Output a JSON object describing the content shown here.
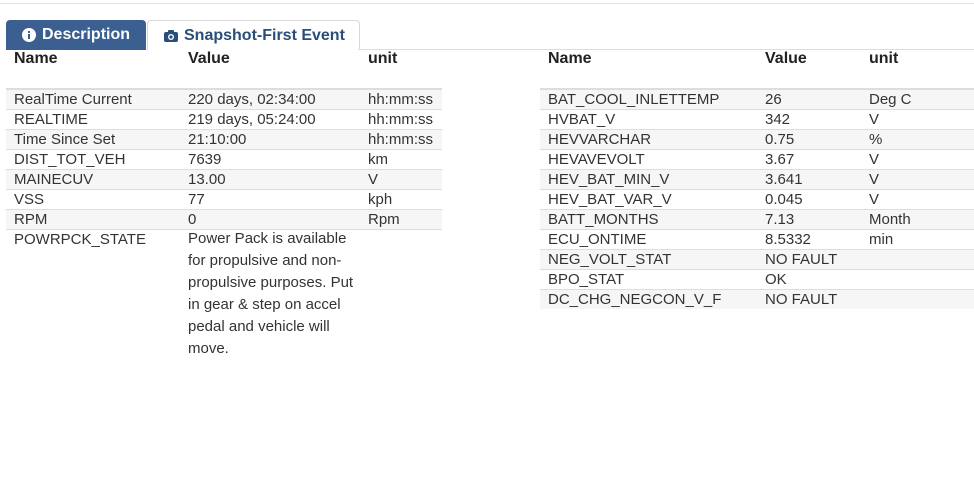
{
  "tabs": {
    "description": {
      "label": "Description",
      "icon": "info-circle-icon"
    },
    "snapshot": {
      "label": "Snapshot-First Event",
      "icon": "camera-icon"
    }
  },
  "colors": {
    "active_tab": "#3a5f90",
    "inactive_tab_text": "#2a4e7a",
    "stripe": "#f6f6f6"
  },
  "left_table": {
    "headers": [
      "Name",
      "Value",
      "unit"
    ],
    "rows": [
      [
        "RealTime Current",
        "220 days, 02:34:00",
        "hh:mm:ss"
      ],
      [
        "REALTIME",
        "219 days, 05:24:00",
        "hh:mm:ss"
      ],
      [
        "Time Since Set",
        "21:10:00",
        "hh:mm:ss"
      ],
      [
        "DIST_TOT_VEH",
        "7639",
        "km"
      ],
      [
        "MAINECUV",
        "13.00",
        "V"
      ],
      [
        "VSS",
        "77",
        "kph"
      ],
      [
        "RPM",
        "0",
        "Rpm"
      ],
      [
        "POWRPCK_STATE",
        "Power Pack is available for propulsive and non-propulsive purposes. Put in gear & step on accel pedal and vehicle will move.",
        ""
      ]
    ]
  },
  "right_table": {
    "headers": [
      "Name",
      "Value",
      "unit"
    ],
    "rows": [
      [
        "BAT_COOL_INLETTEMP",
        "26",
        "Deg C"
      ],
      [
        "HVBAT_V",
        "342",
        "V"
      ],
      [
        "HEVVARCHAR",
        "0.75",
        "%"
      ],
      [
        "HEVAVEVOLT",
        "3.67",
        "V"
      ],
      [
        "HEV_BAT_MIN_V",
        "3.641",
        "V"
      ],
      [
        "HEV_BAT_VAR_V",
        "0.045",
        "V"
      ],
      [
        "BATT_MONTHS",
        "7.13",
        "Month"
      ],
      [
        "ECU_ONTIME",
        "8.5332",
        "min"
      ],
      [
        "NEG_VOLT_STAT",
        "NO FAULT",
        ""
      ],
      [
        "BPO_STAT",
        "OK",
        ""
      ],
      [
        "DC_CHG_NEGCON_V_F",
        "NO FAULT",
        ""
      ]
    ]
  }
}
